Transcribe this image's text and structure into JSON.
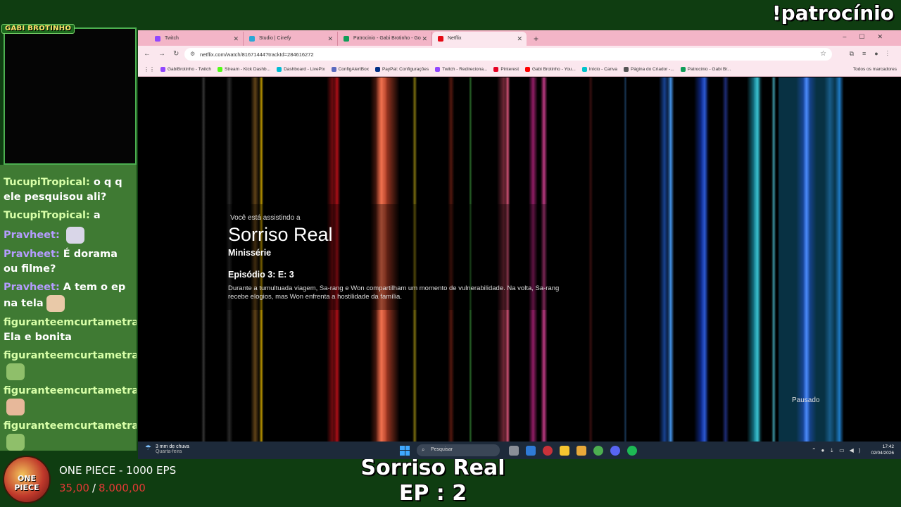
{
  "overlay": {
    "corner_text": "!patrocínio",
    "cam_label": "GABI BROTINHO",
    "show_title": "Sorriso Real",
    "show_episode": "EP : 2"
  },
  "chat": [
    {
      "user": "TucupiTropical",
      "text": "o q q ele pesquisou ali?",
      "color": "green"
    },
    {
      "user": "TucupiTropical",
      "text": "a",
      "color": "green"
    },
    {
      "user": "Pravheet",
      "text": "",
      "emote": "cat-emote",
      "color": "purple"
    },
    {
      "user": "Pravheet",
      "text": "É dorama ou filme?",
      "color": "purple"
    },
    {
      "user": "Pravheet",
      "text": "A tem o ep na tela",
      "emote": "face-emote",
      "color": "purple"
    },
    {
      "user": "figuranteemcurtametrage",
      "text": "Ela e bonita",
      "color": "green"
    },
    {
      "user": "figuranteemcurtametrage",
      "text": "",
      "emote": "girl-emote",
      "color": "green"
    },
    {
      "user": "figuranteemcurtametrage",
      "text": "",
      "emote": "thumbs-emote",
      "color": "green"
    },
    {
      "user": "figuranteemcurtametrage",
      "text": "",
      "emote": "girl-emote",
      "color": "green"
    }
  ],
  "goal": {
    "logo_text": "ONE PIECE",
    "title": "ONE PIECE - 1000 EPS",
    "current": "35,00",
    "target": "8.000,00"
  },
  "browser": {
    "tabs": [
      {
        "label": "Twitch",
        "color": "#9146ff"
      },
      {
        "label": "Studio | Cinefy",
        "color": "#2aa7d6"
      },
      {
        "label": "Patrocinio - Gabi Brotinho - Go",
        "color": "#0f9d58"
      },
      {
        "label": "Netflix",
        "color": "#e50914",
        "active": true
      }
    ],
    "url": "netflix.com/watch/81671444?trackId=284616272",
    "bookmarks": [
      {
        "label": "GabiBrotinho - Twitch",
        "color": "#9146ff"
      },
      {
        "label": "Stream - Kick Dashb...",
        "color": "#53fc18"
      },
      {
        "label": "Dashboard - LivePix",
        "color": "#00bcd4"
      },
      {
        "label": "ConfigAlertBox",
        "color": "#5b6abf"
      },
      {
        "label": "PayPal: Configurações",
        "color": "#003087"
      },
      {
        "label": "Twitch - Redireciona...",
        "color": "#9146ff"
      },
      {
        "label": "Pinterest",
        "color": "#e60023"
      },
      {
        "label": "Gabi Brotinho - You...",
        "color": "#ff0000"
      },
      {
        "label": "Início - Canva",
        "color": "#00c4cc"
      },
      {
        "label": "Página do Criador -...",
        "color": "#555555"
      },
      {
        "label": "Patrocinio - Gabi Br...",
        "color": "#0f9d58"
      }
    ],
    "bookmarks_all": "Todos os marcadores"
  },
  "player": {
    "pre": "Você está assistindo a",
    "title": "Sorriso Real",
    "type": "Minissérie",
    "episode": "Episódio 3: E: 3",
    "description": "Durante a tumultuada viagem, Sa-rang e Won compartilham um momento de vulnerabilidade. Na volta, Sa-rang recebe elogios, mas Won enfrenta a hostilidade da família.",
    "status": "Pausado"
  },
  "taskbar": {
    "weather_line1": "3 mm de chuva",
    "weather_line2": "Quarta-feira",
    "search_placeholder": "Pesquisar",
    "time": "17:42",
    "date": "02/04/2026"
  }
}
